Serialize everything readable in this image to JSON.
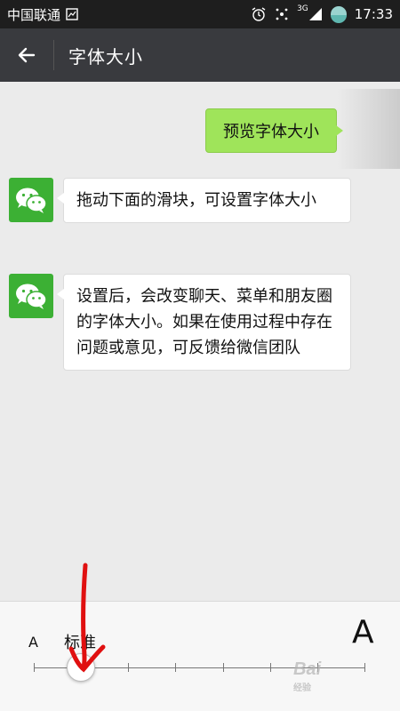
{
  "status_bar": {
    "carrier": "中国联通",
    "network": "3G",
    "time": "17:33",
    "icons": [
      "image-icon",
      "alarm-icon",
      "sync-icon",
      "signal-icon",
      "battery-icon"
    ]
  },
  "title_bar": {
    "back_icon": "back-arrow-icon",
    "title": "字体大小"
  },
  "chat": {
    "sent_message": "预览字体大小",
    "received_messages": [
      "拖动下面的滑块，可设置字体大小",
      "设置后，会改变聊天、菜单和朋友圈的字体大小。如果在使用过程中存在问题或意见，可反馈给微信团队"
    ]
  },
  "font_slider": {
    "small_label": "A",
    "current_label": "标准",
    "large_label": "A",
    "steps": 8,
    "selected_step": 1
  },
  "watermark": {
    "text": "Bai",
    "sub": "经验"
  },
  "colors": {
    "title_bar": "#393a3e",
    "status_bar": "#1e1e1e",
    "sent_bubble": "#9fe45a",
    "avatar": "#3cb034",
    "annotation": "#e01010"
  }
}
